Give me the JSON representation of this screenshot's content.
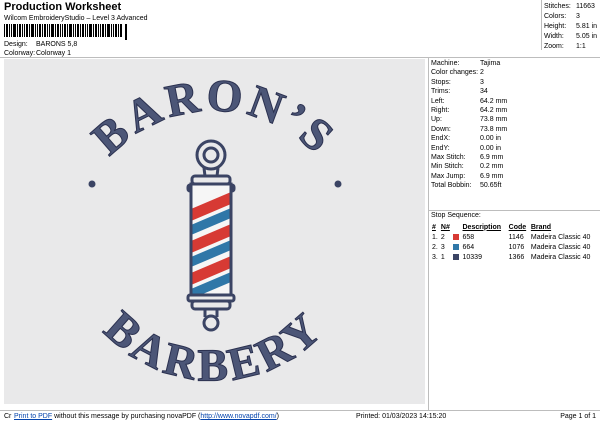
{
  "header": {
    "title": "Production Worksheet",
    "software": "Wilcom EmbroideryStudio – Level 3 Advanced",
    "design_label": "Design:",
    "design_value": "BARONS 5,8",
    "colorway_label": "Colorway:",
    "colorway_value": "Colorway 1"
  },
  "stats": [
    {
      "label": "Stitches:",
      "value": "11663"
    },
    {
      "label": "Colors:",
      "value": "3"
    },
    {
      "label": "Height:",
      "value": "5.81 in"
    },
    {
      "label": "Width:",
      "value": "5.05 in"
    },
    {
      "label": "Zoom:",
      "value": "1:1"
    }
  ],
  "design_text": {
    "top": "BARON’S",
    "bottom": "BARBERY"
  },
  "machine_info": [
    {
      "label": "Machine:",
      "value": "Tajima"
    },
    {
      "label": "Color changes:",
      "value": "2"
    },
    {
      "label": "Stops:",
      "value": "3"
    },
    {
      "label": "Trims:",
      "value": "34"
    },
    {
      "label": "Left:",
      "value": "64.2 mm"
    },
    {
      "label": "Right:",
      "value": "64.2 mm"
    },
    {
      "label": "Up:",
      "value": "73.8 mm"
    },
    {
      "label": "Down:",
      "value": "73.8 mm"
    },
    {
      "label": "EndX:",
      "value": "0.00 in"
    },
    {
      "label": "EndY:",
      "value": "0.00 in"
    },
    {
      "label": "Max Stitch:",
      "value": "6.9 mm"
    },
    {
      "label": "Min Stitch:",
      "value": "0.2 mm"
    },
    {
      "label": "Max Jump:",
      "value": "6.9 mm"
    },
    {
      "label": "Total Bobbin:",
      "value": "50.65ft"
    }
  ],
  "stop_sequence": {
    "heading": "Stop Sequence:",
    "columns": [
      "#",
      "N#",
      "",
      "Description",
      "Code",
      "Brand"
    ],
    "rows": [
      {
        "num": "1.",
        "n": "2",
        "color": "#d73a34",
        "description": "658",
        "code": "1146",
        "brand": "Madeira Classic 40"
      },
      {
        "num": "2.",
        "n": "3",
        "color": "#2f77a8",
        "description": "664",
        "code": "1076",
        "brand": "Madeira Classic 40"
      },
      {
        "num": "3.",
        "n": "1",
        "color": "#3b4464",
        "description": "10339",
        "code": "1366",
        "brand": "Madeira Classic 40"
      }
    ]
  },
  "footer": {
    "cr": "Cr",
    "print_link": "Print to PDF",
    "middle": "without this message by purchasing novaPDF (",
    "url": "http://www.novapdf.com/",
    "tail": ")",
    "printed": "Printed: 01/03/2023 14:15:20",
    "page": "Page 1 of 1"
  },
  "colors": {
    "navy": "#3b4464",
    "red": "#d73a34",
    "blue": "#2f77a8",
    "background": "#e9e9ea"
  }
}
